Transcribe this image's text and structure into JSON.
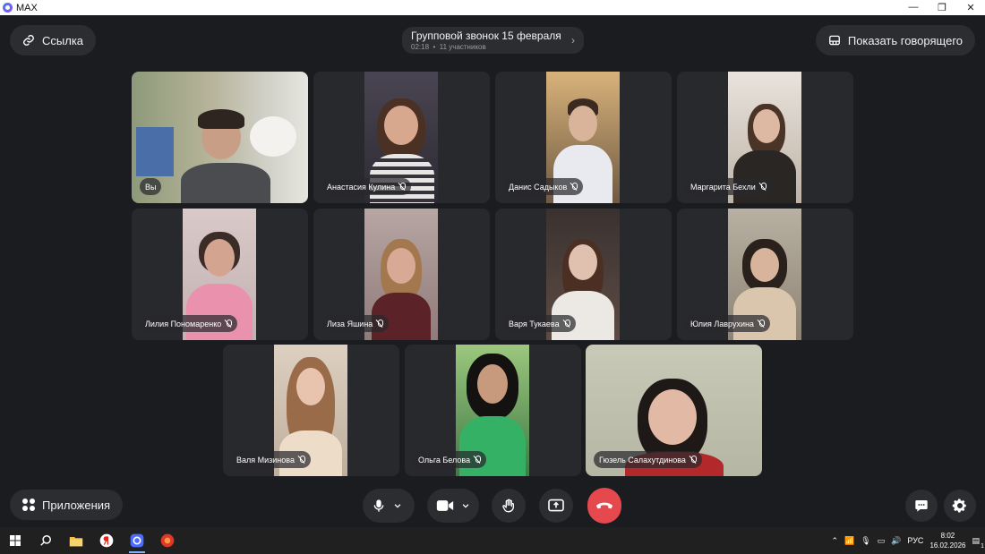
{
  "window": {
    "title": "MAX",
    "controls": [
      "—",
      "❐",
      "✕"
    ]
  },
  "header": {
    "link_label": "Ссылка",
    "call_title": "Групповой звонок 15 февраля",
    "call_duration": "02:18",
    "call_separator": "•",
    "participants_count": "11 участников",
    "show_speaker_label": "Показать говорящего"
  },
  "participants": [
    {
      "name": "Вы",
      "muted": false
    },
    {
      "name": "Анастасия Кулина",
      "muted": true
    },
    {
      "name": "Данис Садыков",
      "muted": true
    },
    {
      "name": "Маргарита Бехли",
      "muted": true
    },
    {
      "name": "Лилия Пономаренко",
      "muted": true
    },
    {
      "name": "Лиза Яшина",
      "muted": true
    },
    {
      "name": "Варя Тукаева",
      "muted": true
    },
    {
      "name": "Юлия Лаврухина",
      "muted": true
    },
    {
      "name": "Валя Мизинова",
      "muted": true
    },
    {
      "name": "Ольга Белова",
      "muted": true
    },
    {
      "name": "Гюзель Салахутдинова",
      "muted": true
    }
  ],
  "toolbar": {
    "apps_label": "Приложения"
  },
  "colors": {
    "background": "#1b1c1f",
    "tile": "#28292d",
    "button": "#2c2d31",
    "hangup": "#e5484d"
  },
  "taskbar": {
    "language": "РУС",
    "time": "8:02",
    "date": "16.02.2026",
    "notification_count": "1"
  }
}
